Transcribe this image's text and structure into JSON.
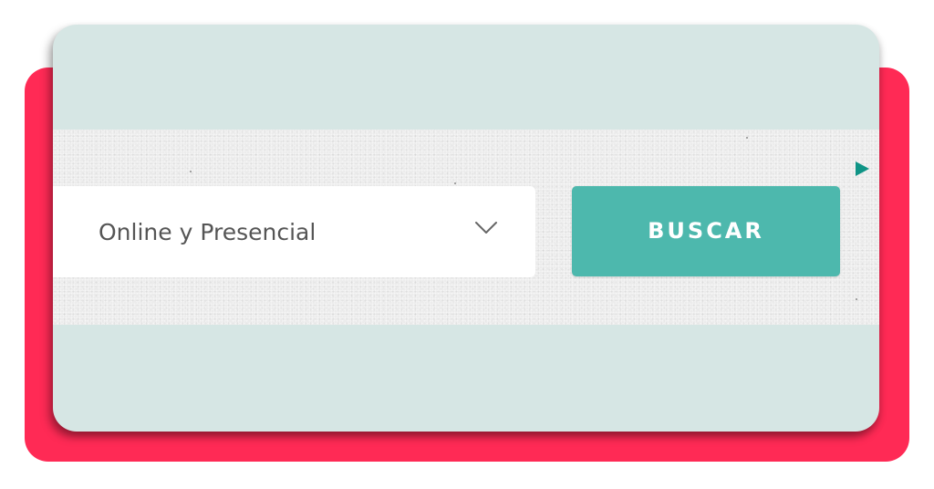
{
  "search_bar": {
    "modality_select": {
      "selected_value": "Online y Presencial"
    },
    "search_button_label": "BUSCAR"
  },
  "icons": {
    "dropdown": "chevron-down-icon",
    "next": "play-icon"
  },
  "colors": {
    "frame_accent": "#ff2a55",
    "card_background": "#d6e6e4",
    "button": "#4db8ad",
    "play_arrow": "#0f9486",
    "select_text": "#555555"
  }
}
